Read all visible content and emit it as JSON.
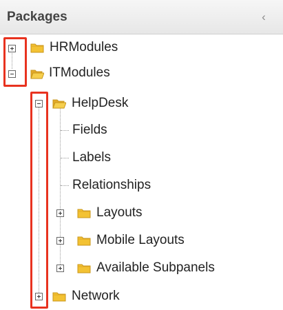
{
  "panel": {
    "title": "Packages",
    "collapse_icon": "‹"
  },
  "tree": {
    "hrmodules": "HRModules",
    "itmodules": "ITModules",
    "helpdesk": "HelpDesk",
    "fields": "Fields",
    "labels": "Labels",
    "relationships": "Relationships",
    "layouts": "Layouts",
    "mobile_layouts": "Mobile Layouts",
    "available_subpanels": "Available Subpanels",
    "network": "Network"
  },
  "colors": {
    "highlight": "#e8321f",
    "folder_fill": "#f3c233",
    "folder_stroke": "#c8961a"
  }
}
